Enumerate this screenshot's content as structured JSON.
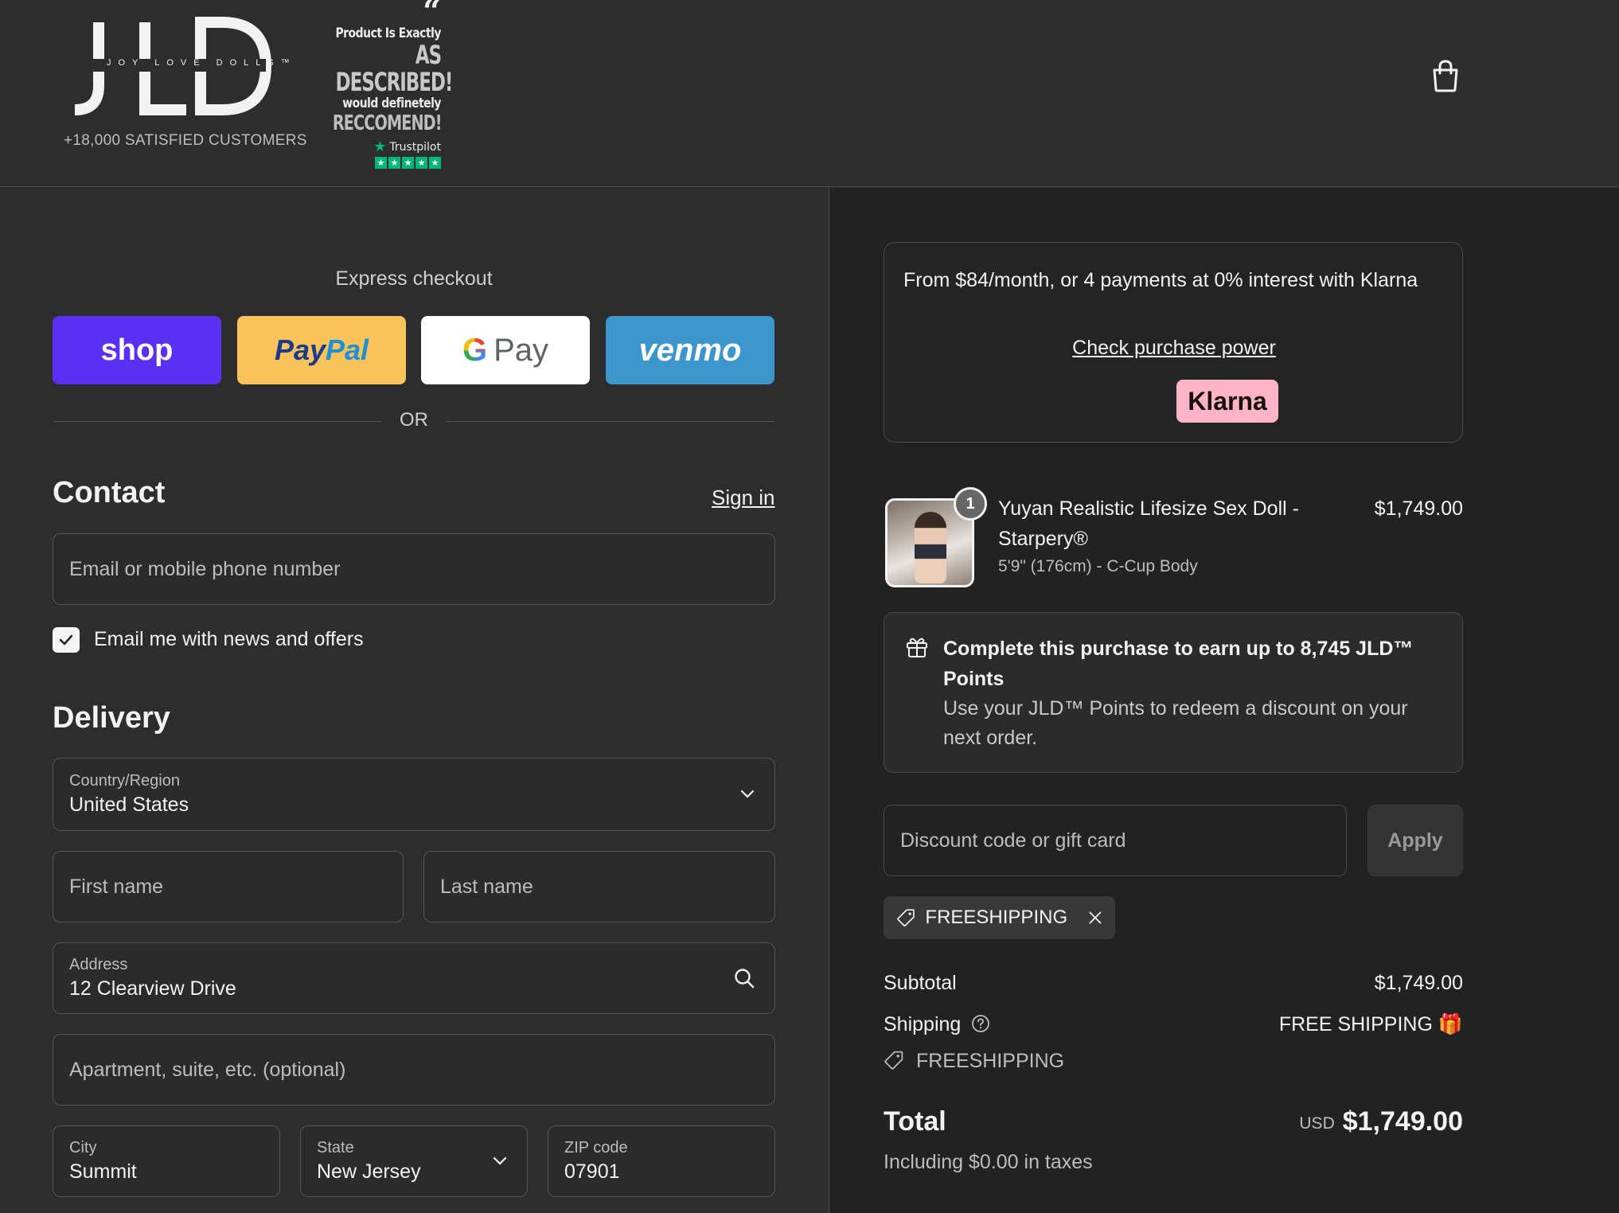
{
  "header": {
    "logo_text": "JLD",
    "logo_tagline": "JOY LOVE DOLLS™",
    "customers": "+18,000  SATISFIED CUSTOMERS",
    "review": {
      "line1": "Product Is Exactly",
      "line2": "AS DESCRIBED!",
      "line3": "would definetely",
      "line4": "RECCOMEND!",
      "trustpilot": "Trustpilot"
    },
    "cart_icon": "shopping-bag-icon"
  },
  "express": {
    "title": "Express checkout",
    "shop": "shop",
    "paypal_a": "Pay",
    "paypal_b": "Pal",
    "gpay_g": "G",
    "gpay": "Pay",
    "venmo": "venmo",
    "or": "OR"
  },
  "contact": {
    "title": "Contact",
    "signin": "Sign in",
    "email_placeholder": "Email or mobile phone number",
    "newsletter_label": "Email me with news and offers",
    "newsletter_checked": true
  },
  "delivery": {
    "title": "Delivery",
    "country_label": "Country/Region",
    "country_value": "United States",
    "first_name_placeholder": "First name",
    "last_name_placeholder": "Last name",
    "address_label": "Address",
    "address_value": "12 Clearview Drive",
    "apartment_placeholder": "Apartment, suite, etc. (optional)",
    "city_label": "City",
    "city_value": "Summit",
    "state_label": "State",
    "state_value": "New Jersey",
    "zip_label": "ZIP code",
    "zip_value": "07901"
  },
  "summary": {
    "klarna_text": "From $84/month, or 4 payments at 0% interest with Klarna",
    "klarna_link": "Check purchase power",
    "klarna_badge": "Klarna",
    "product": {
      "quantity": "1",
      "name": "Yuyan Realistic Lifesize Sex Doll - Starpery®",
      "variant": "5'9\" (176cm) - C-Cup Body",
      "price": "$1,749.00"
    },
    "points_title": "Complete this purchase to earn up to 8,745 JLD™ Points",
    "points_sub": "Use your JLD™ Points to redeem a discount on your next order.",
    "discount_placeholder": "Discount code or gift card",
    "apply": "Apply",
    "applied_code": "FREESHIPPING",
    "subtotal_label": "Subtotal",
    "subtotal_value": "$1,749.00",
    "shipping_label": "Shipping",
    "shipping_value": "FREE SHIPPING 🎁",
    "shipping_code": "FREESHIPPING",
    "total_label": "Total",
    "currency": "USD",
    "total_value": "$1,749.00",
    "taxes": "Including $0.00 in taxes"
  }
}
